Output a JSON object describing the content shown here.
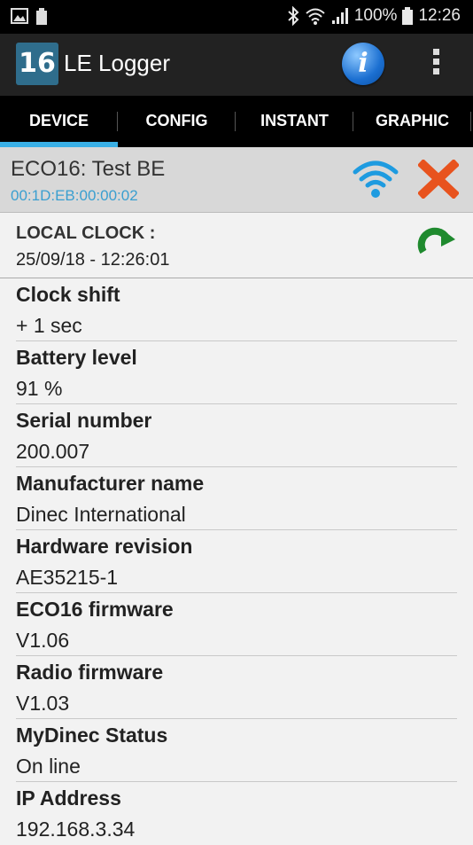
{
  "status_bar": {
    "battery_percent": "100%",
    "time": "12:26",
    "icons": [
      "gallery-icon",
      "battery-saver-icon",
      "bluetooth-icon",
      "wifi-signal-icon",
      "cell-signal-icon",
      "battery-icon"
    ]
  },
  "app_bar": {
    "logo_text": "16",
    "title": "LE Logger",
    "info_label": "i"
  },
  "tabs": [
    {
      "label": "DEVICE",
      "active": true
    },
    {
      "label": "CONFIG",
      "active": false
    },
    {
      "label": "INSTANT",
      "active": false
    },
    {
      "label": "GRAPHIC",
      "active": false
    }
  ],
  "device": {
    "name": "ECO16: Test BE",
    "mac": "00:1D:EB:00:00:02"
  },
  "clock": {
    "label": "LOCAL CLOCK :",
    "value": "25/09/18 - 12:26:01"
  },
  "properties": [
    {
      "label": "Clock shift",
      "value": "+ 1 sec"
    },
    {
      "label": "Battery level",
      "value": "91 %"
    },
    {
      "label": "Serial number",
      "value": "200.007"
    },
    {
      "label": "Manufacturer name",
      "value": "Dinec International"
    },
    {
      "label": "Hardware revision",
      "value": "AE35215-1"
    },
    {
      "label": "ECO16 firmware",
      "value": "V1.06"
    },
    {
      "label": "Radio firmware",
      "value": "V1.03"
    },
    {
      "label": "MyDinec Status",
      "value": "On line"
    },
    {
      "label": "IP Address",
      "value": "192.168.3.34"
    }
  ],
  "colors": {
    "accent": "#3ab0e6",
    "mac_text": "#3a9fd0",
    "close": "#e8531e",
    "refresh": "#1f8a2e",
    "wifi": "#1e9be0"
  }
}
